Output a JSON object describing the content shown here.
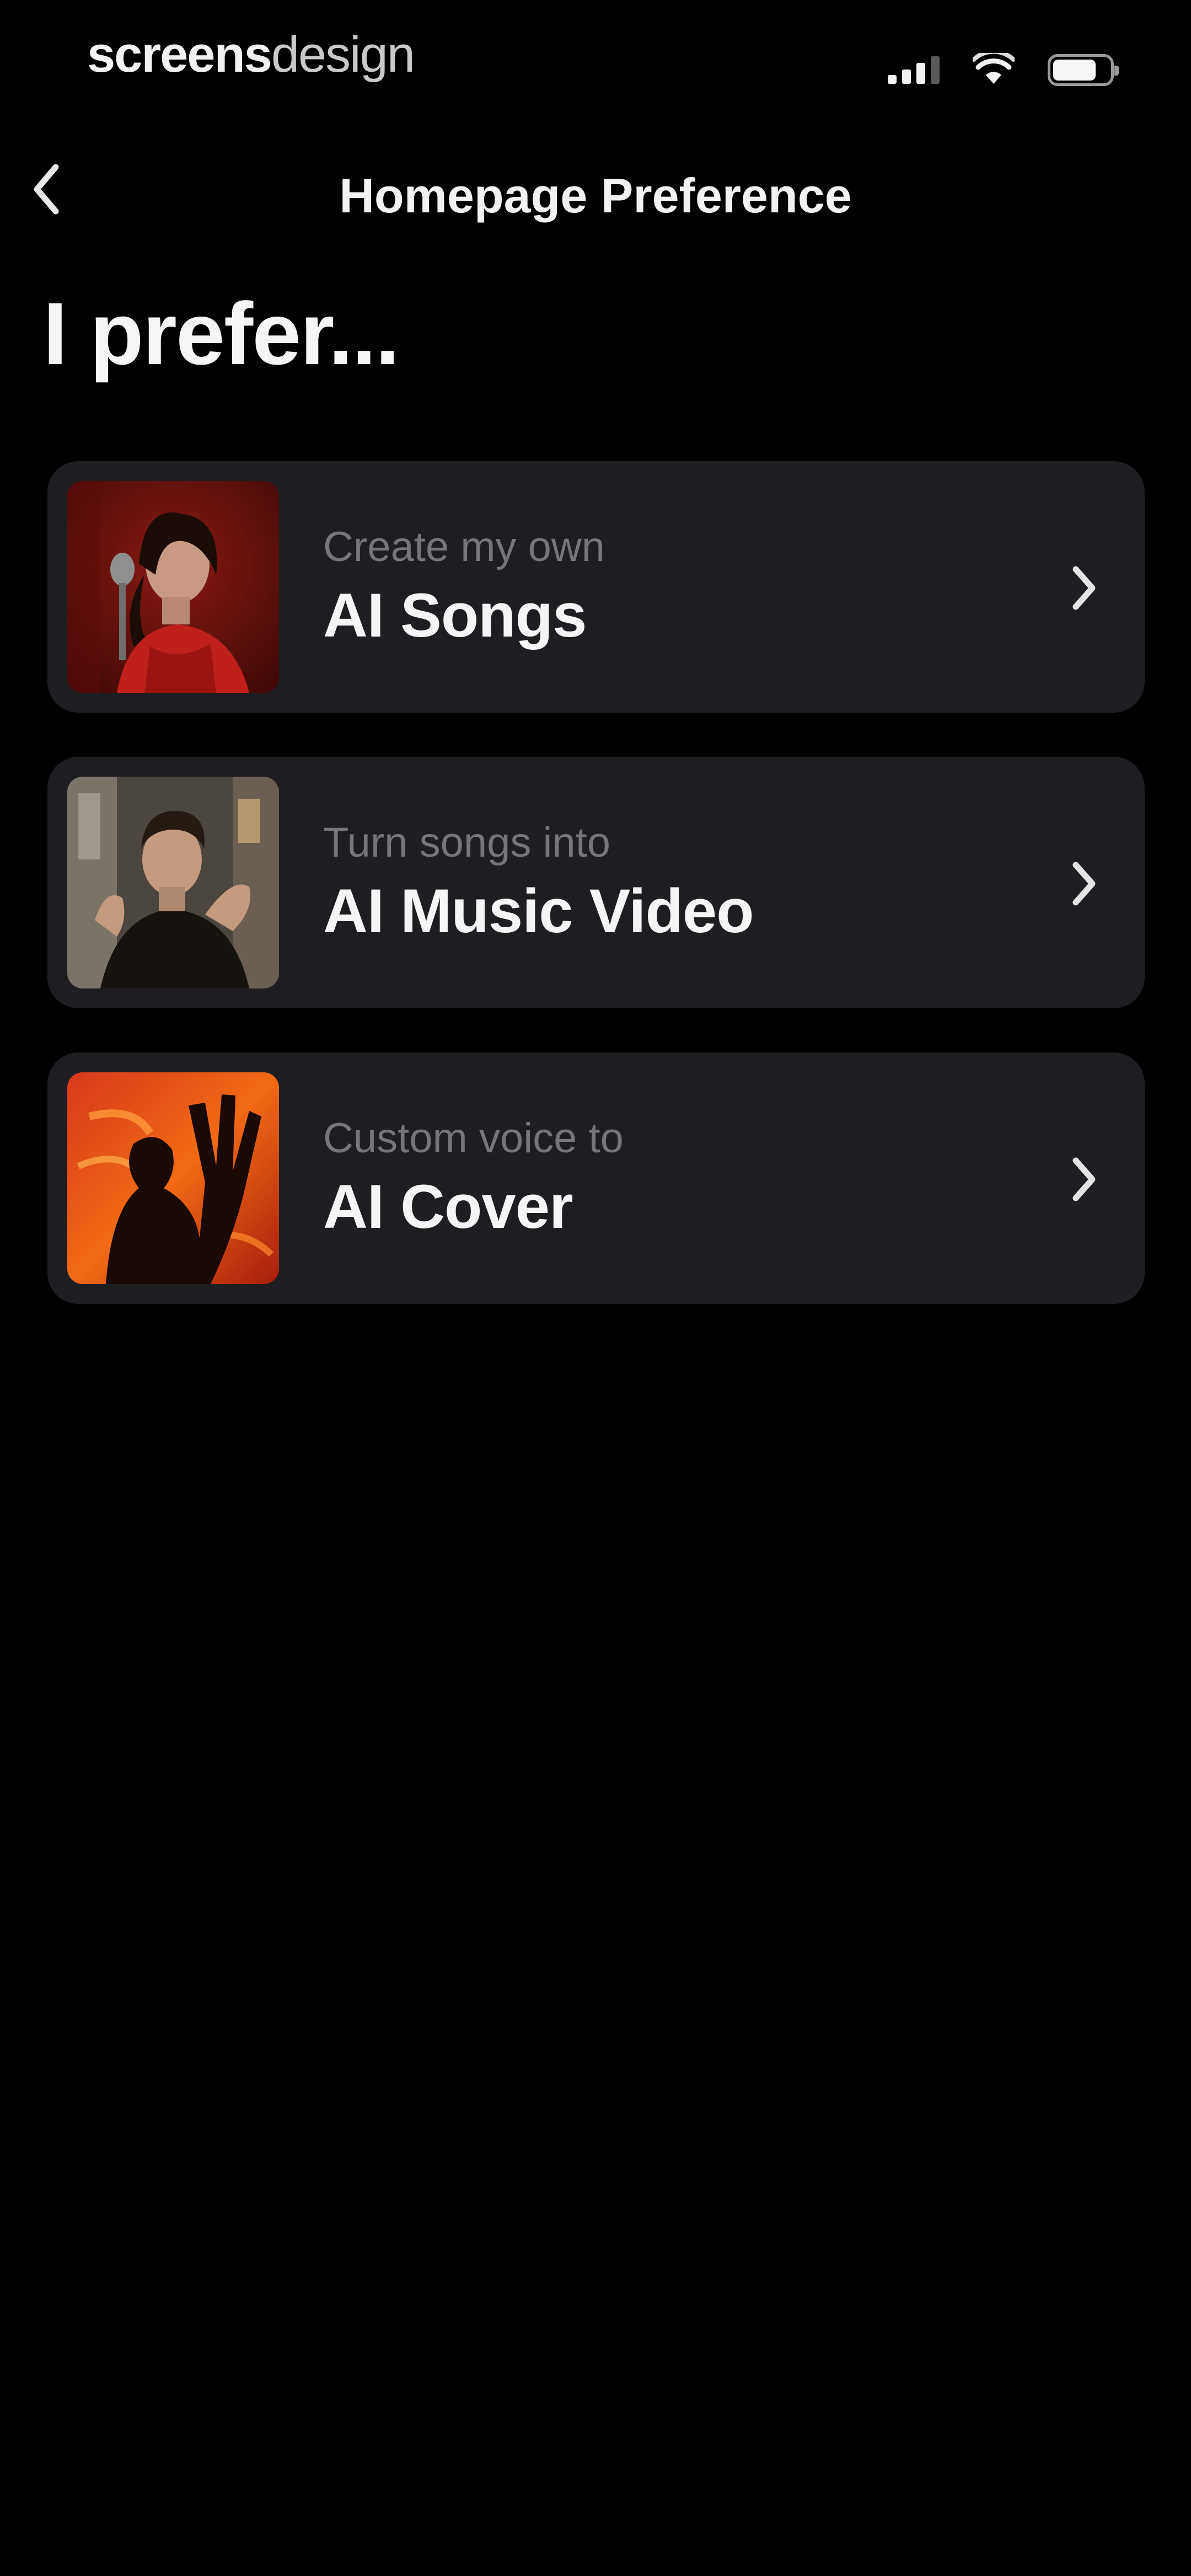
{
  "status_bar": {
    "brand_bold": "screens",
    "brand_light": "design",
    "battery_level": 0.85,
    "icons": [
      "signal-icon",
      "wifi-icon",
      "battery-icon"
    ]
  },
  "nav": {
    "back_icon": "chevron-left-icon",
    "title": "Homepage Preference"
  },
  "heading": "I prefer...",
  "options": [
    {
      "subtitle": "Create my own",
      "title": "AI Songs",
      "thumbnail": "singer-with-microphone",
      "icon": "chevron-right-icon"
    },
    {
      "subtitle": "Turn songs into",
      "title": "AI Music Video",
      "thumbnail": "man-in-music-video",
      "icon": "chevron-right-icon"
    },
    {
      "subtitle": "Custom voice to",
      "title": "AI Cover",
      "thumbnail": "silhouette-raised-hand",
      "icon": "chevron-right-icon"
    }
  ],
  "colors": {
    "background": "#000000",
    "card": "#1e1d22",
    "subtitle": "#76757c",
    "text": "#f5f5f5"
  }
}
